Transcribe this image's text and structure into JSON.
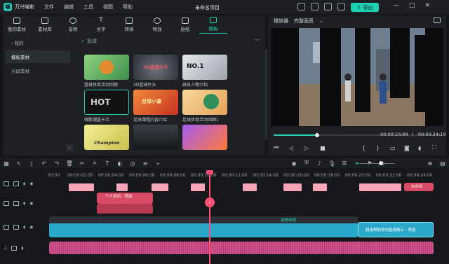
{
  "app": {
    "name": "万兴喵影",
    "project": "未命名项目"
  },
  "menu": [
    "文件",
    "编辑",
    "工具",
    "视图",
    "帮助"
  ],
  "export_label": "导出",
  "window_controls": [
    "—",
    "□",
    "✕"
  ],
  "top_tabs": [
    {
      "label": "我的素材",
      "icon": "folder-icon"
    },
    {
      "label": "素材库",
      "icon": "library-icon"
    },
    {
      "label": "音频",
      "icon": "music-icon"
    },
    {
      "label": "文字",
      "icon": "text-icon"
    },
    {
      "label": "转场",
      "icon": "transition-icon"
    },
    {
      "label": "特效",
      "icon": "effects-icon"
    },
    {
      "label": "贴纸",
      "icon": "sticker-icon"
    },
    {
      "label": "模板",
      "icon": "template-icon"
    }
  ],
  "tree": [
    {
      "label": "› 我的"
    },
    {
      "label": "模板素材"
    },
    {
      "label": "分屏素材"
    }
  ],
  "search": {
    "query": "篮球"
  },
  "templates": [
    {
      "label": "篮球体育活动回顾",
      "bg": "#6fbf6a",
      "text": ""
    },
    {
      "label": "3D篮球片头",
      "bg": "#3b3f4a",
      "text": "3D篮球片头"
    },
    {
      "label": "球员人物介绍",
      "bg": "#c9ccd2",
      "text": "NO.1"
    },
    {
      "label": "嗨歌潮篮卡点",
      "bg": "#1b1b1b",
      "text": "HOT"
    },
    {
      "label": "足球课程内容介绍",
      "bg": "#d8402f",
      "text": "足球小课"
    },
    {
      "label": "足球体育活动回顾1",
      "bg": "#f3c68a",
      "text": ""
    },
    {
      "label": "",
      "bg": "#e9e27a",
      "text": "Champion"
    },
    {
      "label": "",
      "bg": "#24282e",
      "text": ""
    },
    {
      "label": "",
      "bg": "#7b3fd6",
      "text": ""
    }
  ],
  "player": {
    "mode": "播放器",
    "quality": "完整画质",
    "current_time": "00:00:10:09",
    "total_time": "00:00:24:19",
    "progress": 0.26,
    "controls": [
      "prev-frame-icon",
      "rewind-icon",
      "play-icon",
      "stop-icon"
    ],
    "right_controls": [
      "mark-in-icon",
      "mark-out-icon",
      "monitor-icon",
      "screenshot-icon",
      "volume-icon",
      "fullscreen-icon"
    ]
  },
  "ruler_ticks": [
    "00:00",
    "00:00:02:00",
    "00:00:04:00",
    "00:00:06:00",
    "00:00:08:00",
    "00:00:10:00",
    "00:00:12:00",
    "00:00:14:00",
    "00:00:16:00",
    "00:00:18:00",
    "00:00:20:00",
    "00:00:22:00",
    "00:00:24:00"
  ],
  "clips": {
    "title_clip": "个人培训 - 预选",
    "main_text": "超级帮助你的篮球展示 - 预选",
    "text_top": "激情球速",
    "track3_end": "未命名"
  },
  "colors": {
    "accent": "#1fd1b3",
    "playhead": "#ff4f73",
    "video_clip": "#2aa8c9",
    "text_clip": "#d94a64",
    "audio_clip": "#d44f8d"
  }
}
